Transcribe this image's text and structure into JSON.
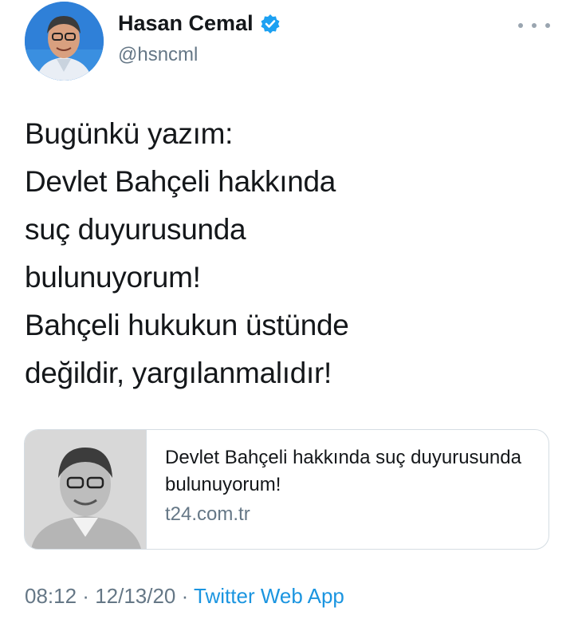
{
  "header": {
    "display_name": "Hasan Cemal",
    "handle": "@hsncml",
    "verified_icon": "verified-badge-icon",
    "more_icon": "more-options-icon"
  },
  "tweet": {
    "lines": [
      "Bugünkü yazım:",
      "Devlet Bahçeli hakkında",
      "suç duyurusunda",
      "bulunuyorum!",
      "Bahçeli hukukun üstünde",
      "değildir, yargılanmalıdır!"
    ]
  },
  "card": {
    "title": "Devlet Bahçeli hakkında suç duyurusunda bulunuyorum!",
    "domain": "t24.com.tr"
  },
  "meta": {
    "time": "08:12",
    "date": "12/13/20",
    "separator": " · ",
    "source": "Twitter Web App"
  },
  "colors": {
    "text": "#14171a",
    "secondary": "#657786",
    "link": "#1b95e0",
    "verified": "#1da1f2"
  }
}
